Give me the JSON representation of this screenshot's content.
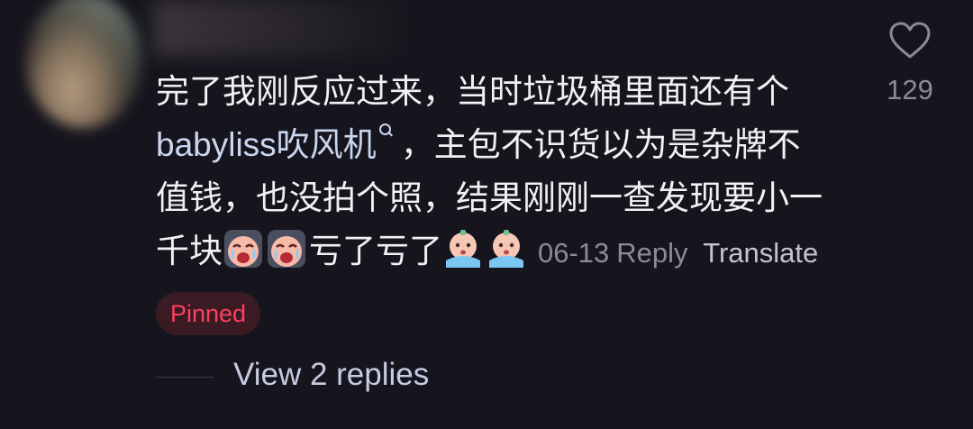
{
  "comment": {
    "lines": [
      "完了我刚反应过来，当时垃圾桶里面还有个",
      "，主包不识货以为是杂牌不",
      "值钱，也没拍个照，结果刚刚一查发现要小一"
    ],
    "search_link": "babyliss吹风机",
    "line4_start": "千块",
    "line4_middle": "亏了亏了",
    "date": "06-13",
    "reply_label": "Reply",
    "translate_label": "Translate"
  },
  "likes": {
    "count": "129",
    "icon": "heart-outline-icon"
  },
  "pinned_label": "Pinned",
  "view_replies_label": "View 2 replies",
  "colors": {
    "background": "#16151d",
    "pinned_text": "#ff3f5e",
    "pinned_bg": "#3a1b23",
    "link": "#c9d6ef",
    "muted": "#8b8b95"
  }
}
